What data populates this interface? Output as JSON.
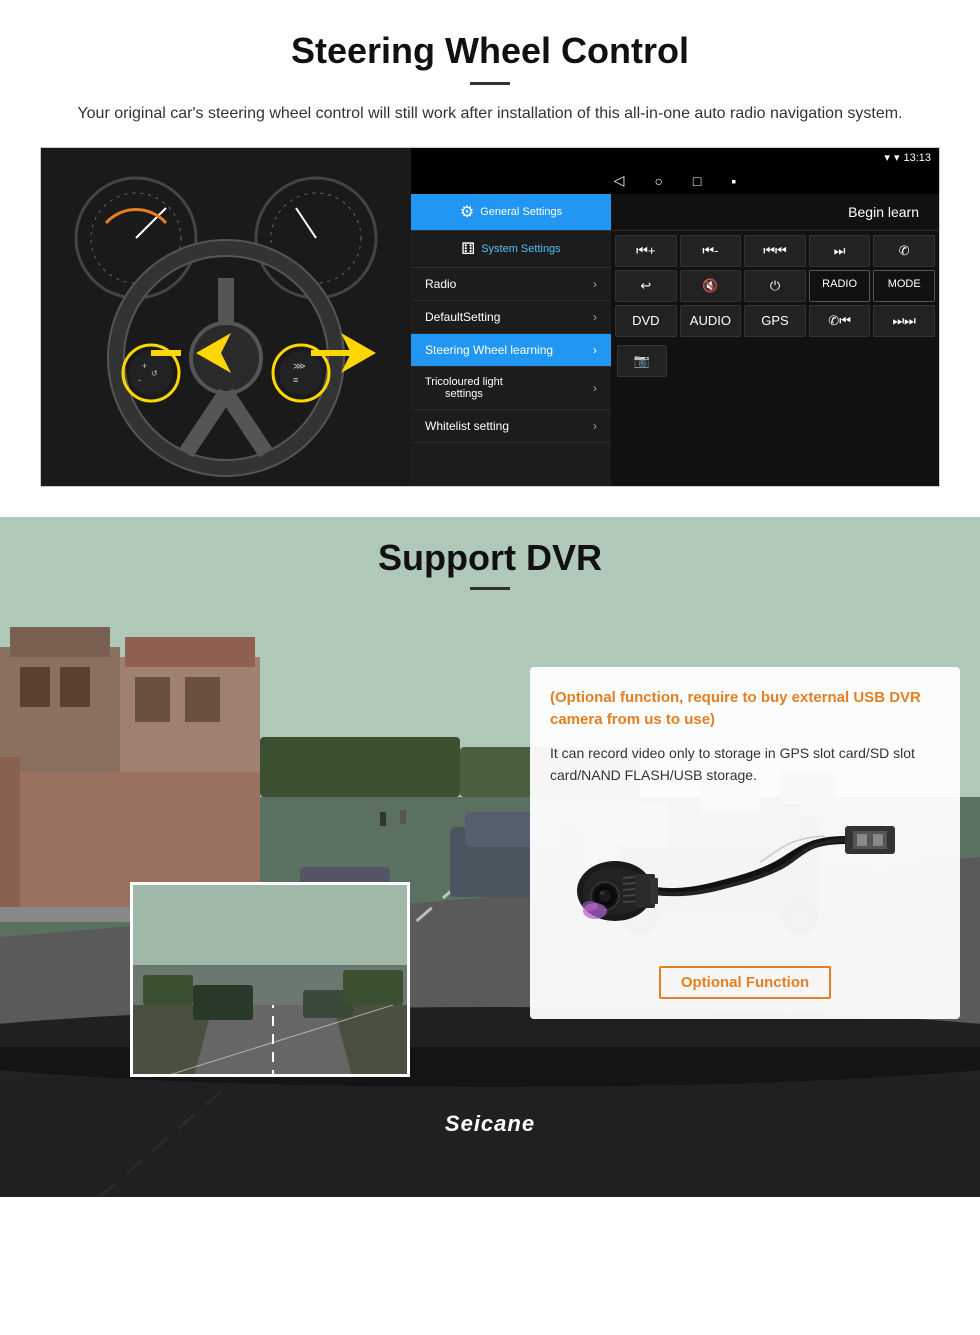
{
  "steering": {
    "title": "Steering Wheel Control",
    "subtitle": "Your original car's steering wheel control will still work after installation of this all-in-one auto radio navigation system.",
    "statusbar": {
      "signal": "▼",
      "wifi": "▾",
      "time": "13:13"
    },
    "navbar": {
      "back": "◁",
      "home": "○",
      "recents": "□",
      "cast": "▪"
    },
    "tabs": {
      "general": "General Settings",
      "system": "System Settings"
    },
    "menu": [
      {
        "label": "Radio",
        "chevron": "›"
      },
      {
        "label": "DefaultSetting",
        "chevron": "›"
      },
      {
        "label": "Steering Wheel learning",
        "chevron": "›",
        "active": true
      },
      {
        "label": "Tricoloured light settings",
        "chevron": "›"
      },
      {
        "label": "Whitelist setting",
        "chevron": "›"
      }
    ],
    "begin_learn": "Begin learn",
    "controls": [
      "⏮+",
      "⏮-",
      "⏮⏮",
      "⏭⏭",
      "✆",
      "↩",
      "🔇",
      "⏻",
      "RADIO",
      "MODE",
      "DVD",
      "AUDIO",
      "GPS",
      "✆⏮",
      "⏭⏭"
    ]
  },
  "dvr": {
    "title": "Support DVR",
    "optional_text": "(Optional function, require to buy external USB DVR camera from us to use)",
    "description": "It can record video only to storage in GPS slot card/SD slot card/NAND FLASH/USB storage.",
    "optional_badge": "Optional Function",
    "brand": "Seicane"
  }
}
